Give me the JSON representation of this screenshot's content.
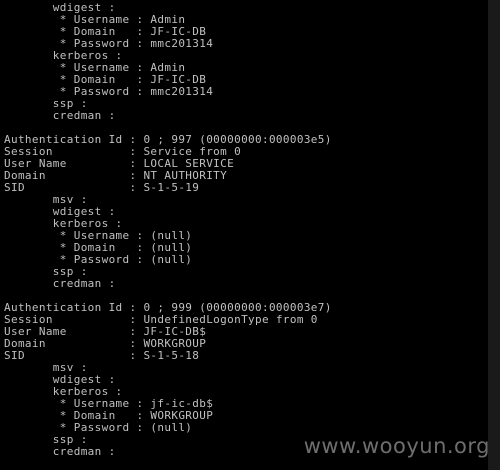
{
  "console": {
    "lines": [
      "       wdigest :",
      "        * Username : Admin",
      "        * Domain   : JF-IC-DB",
      "        * Password : mmc201314",
      "       kerberos :",
      "        * Username : Admin",
      "        * Domain   : JF-IC-DB",
      "        * Password : mmc201314",
      "       ssp :",
      "       credman :",
      "",
      "Authentication Id : 0 ; 997 (00000000:000003e5)",
      "Session           : Service from 0",
      "User Name         : LOCAL SERVICE",
      "Domain            : NT AUTHORITY",
      "SID               : S-1-5-19",
      "       msv :",
      "       wdigest :",
      "       kerberos :",
      "        * Username : (null)",
      "        * Domain   : (null)",
      "        * Password : (null)",
      "       ssp :",
      "       credman :",
      "",
      "Authentication Id : 0 ; 999 (00000000:000003e7)",
      "Session           : UndefinedLogonType from 0",
      "User Name         : JF-IC-DB$",
      "Domain            : WORKGROUP",
      "SID               : S-1-5-18",
      "       msv :",
      "       wdigest :",
      "       kerberos :",
      "        * Username : jf-ic-db$",
      "        * Domain   : WORKGROUP",
      "        * Password : (null)",
      "       ssp :",
      "       credman :"
    ]
  },
  "watermark": "www.wooyun.org",
  "colors": {
    "background": "#000000",
    "text": "#c0c0c0"
  }
}
